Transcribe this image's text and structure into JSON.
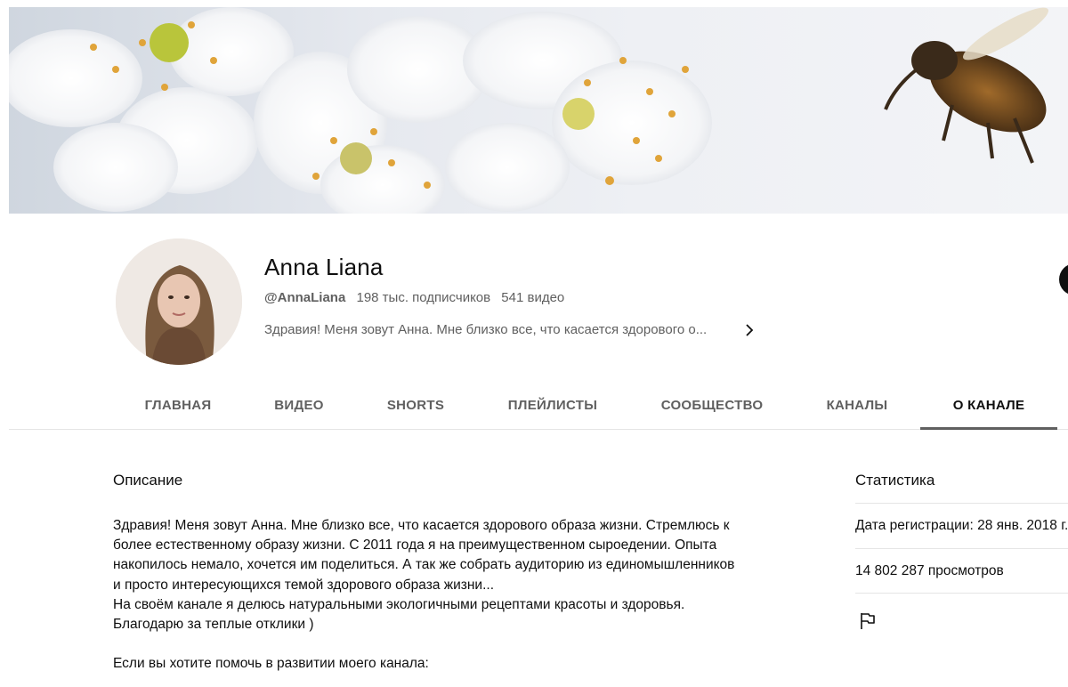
{
  "channel": {
    "name": "Anna Liana",
    "handle": "@AnnaLiana",
    "subscribers": "198 тыс. подписчиков",
    "videos": "541 видео",
    "tagline": "Здравия! Меня зовут Анна. Мне близко все, что касается здорового о..."
  },
  "tabs": [
    {
      "label": "ГЛАВНАЯ"
    },
    {
      "label": "ВИДЕО"
    },
    {
      "label": "SHORTS"
    },
    {
      "label": "ПЛЕЙЛИСТЫ"
    },
    {
      "label": "СООБЩЕСТВО"
    },
    {
      "label": "КАНАЛЫ"
    },
    {
      "label": "О КАНАЛЕ",
      "active": true
    }
  ],
  "about": {
    "description_title": "Описание",
    "description_lines": [
      "Здравия! Меня зовут Анна. Мне близко все, что касается здорового образа жизни.  Стремлюсь к",
      "более естественному образу жизни. С 2011 года я на преимущественном сыроедении. Опыта",
      "накопилось немало, хочется им поделиться. А так же собрать аудиторию из единомышленников",
      "и просто интересующихся темой здорового образа жизни...",
      "На своём канале я делюсь натуральными экологичными рецептами красоты и здоровья.",
      "Благодарю за теплые отклики )",
      "Если вы хотите помочь в развитии моего канала:"
    ]
  },
  "stats": {
    "title": "Статистика",
    "registration": "Дата регистрации: 28 янв. 2018 г.",
    "views": "14 802 287 просмотров"
  },
  "icons": {
    "expand": "chevron-right-icon",
    "report": "flag-icon"
  }
}
